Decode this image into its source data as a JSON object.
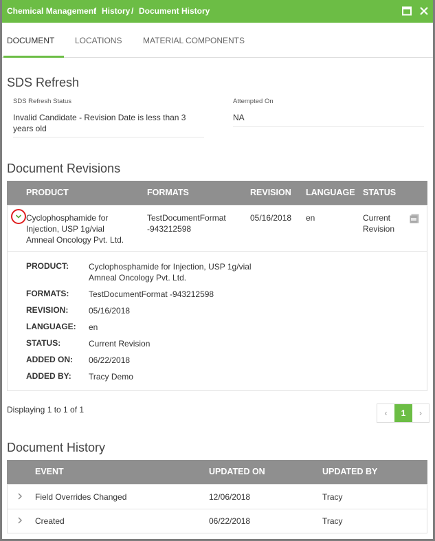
{
  "breadcrumb": [
    "Chemical Management",
    "History",
    "Document History"
  ],
  "breadcrumb_separator": "/",
  "tabs": [
    {
      "label": "DOCUMENT",
      "active": true
    },
    {
      "label": "LOCATIONS",
      "active": false
    },
    {
      "label": "MATERIAL COMPONENTS",
      "active": false
    }
  ],
  "sds_refresh": {
    "heading": "SDS Refresh",
    "status_label": "SDS Refresh Status",
    "status_line1": "Invalid Candidate - Revision Date is less than 3",
    "status_line2": "years old",
    "attempted_label": "Attempted On",
    "attempted_value": "NA"
  },
  "revisions": {
    "heading": "Document Revisions",
    "columns": [
      "PRODUCT",
      "FORMATS",
      "REVISION",
      "LANGUAGE",
      "STATUS"
    ],
    "row": {
      "product_line1": "Cyclophosphamide for",
      "product_line2": "Injection, USP 1g/vial",
      "product_line3": "Amneal Oncology Pvt. Ltd.",
      "formats_line1": "TestDocumentFormat",
      "formats_line2": "-943212598",
      "revision": "05/16/2018",
      "language": "en",
      "status_line1": "Current",
      "status_line2": "Revision",
      "pdf_icon": "pdf-icon"
    },
    "details": [
      {
        "label": "PRODUCT:",
        "value": "Cyclophosphamide for Injection, USP 1g/vial",
        "value2": "Amneal Oncology Pvt. Ltd."
      },
      {
        "label": "FORMATS:",
        "value": "TestDocumentFormat -943212598"
      },
      {
        "label": "REVISION:",
        "value": "05/16/2018"
      },
      {
        "label": "LANGUAGE:",
        "value": "en"
      },
      {
        "label": "STATUS:",
        "value": "Current Revision"
      },
      {
        "label": "ADDED ON:",
        "value": "06/22/2018"
      },
      {
        "label": "ADDED BY:",
        "value": "Tracy Demo"
      }
    ],
    "displaying": "Displaying 1 to 1 of 1",
    "pager": {
      "prev": "‹",
      "current": "1",
      "next": "›"
    }
  },
  "history": {
    "heading": "Document History",
    "columns": [
      "EVENT",
      "UPDATED ON",
      "UPDATED BY"
    ],
    "rows": [
      {
        "event": "Field Overrides Changed",
        "updated_on": "12/06/2018",
        "updated_by": "Tracy"
      },
      {
        "event": "Created",
        "updated_on": "06/22/2018",
        "updated_by": "Tracy"
      }
    ]
  },
  "colors": {
    "accent": "#6cbd45",
    "header_gray": "#8f8f8f",
    "highlight_red": "#e02020"
  }
}
